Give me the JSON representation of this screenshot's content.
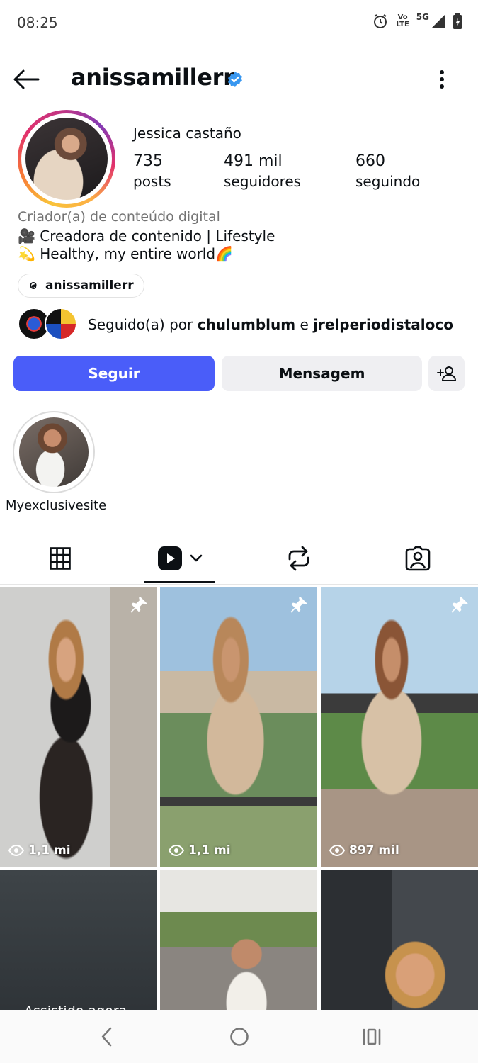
{
  "status_bar": {
    "time": "08:25",
    "volte_top": "Vo",
    "volte_bottom": "LTE",
    "network": "5G",
    "icons": [
      "alarm-icon",
      "volte-icon",
      "signal-icon",
      "battery-icon"
    ]
  },
  "header": {
    "username": "anissamillerr",
    "verified": true,
    "back_icon": "arrow-left-icon",
    "more_icon": "more-vertical-icon"
  },
  "profile": {
    "display_name": "Jessica castaño",
    "stats": [
      {
        "value": "735",
        "label": "posts"
      },
      {
        "value": "491 mil",
        "label": "seguidores"
      },
      {
        "value": "660",
        "label": "seguindo"
      }
    ],
    "category": "Criador(a) de conteúdo digital",
    "bio_lines": [
      "🎥 Creadora de contenido | Lifestyle",
      "💫 Healthy, my entire world🌈"
    ],
    "threads_handle": "anissamillerr",
    "followed_by": {
      "prefix": "Seguido(a) por",
      "user1": "chulumblum",
      "conjunction": "e",
      "user2": "jrelperiodistaloco"
    }
  },
  "actions": {
    "follow": "Seguir",
    "message": "Mensagem",
    "add_user_icon": "add-user-icon"
  },
  "highlight": {
    "label": "Myexclusivesite"
  },
  "tabs": [
    {
      "icon": "grid-icon",
      "active": false
    },
    {
      "icon": "reels-icon",
      "active": true
    },
    {
      "icon": "repost-icon",
      "active": false
    },
    {
      "icon": "tagged-icon",
      "active": false
    }
  ],
  "grid": [
    {
      "views": "1,1 mi",
      "pinned": true
    },
    {
      "views": "1,1 mi",
      "pinned": true
    },
    {
      "views": "897 mil",
      "pinned": true
    },
    {
      "overlay": "Assistido agora",
      "pinned": false
    },
    {
      "pinned": false
    },
    {
      "pinned": false
    }
  ],
  "colors": {
    "accent": "#4a5df9",
    "secondary_button": "#efeff2",
    "verified": "#3897f0"
  }
}
